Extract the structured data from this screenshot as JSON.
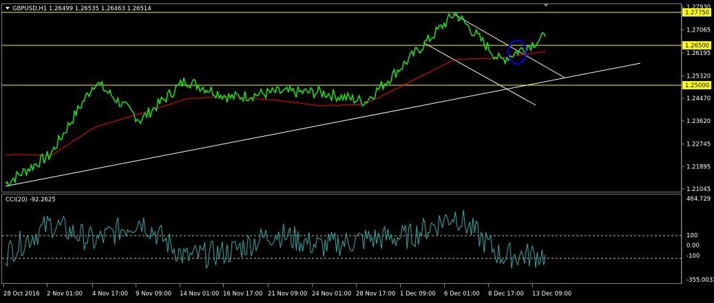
{
  "price_panel": {
    "header": "GBPUSD,H1  1.26499 1.26535 1.26463 1.26514",
    "symbol": "GBPUSD",
    "timeframe": "H1",
    "ohlc": [
      "1.26499",
      "1.26535",
      "1.26463",
      "1.26514"
    ],
    "y_ticks": [
      "1.27930",
      "1.27065",
      "1.26195",
      "1.25320",
      "1.24470",
      "1.23620",
      "1.22745",
      "1.21895",
      "1.21045"
    ],
    "level_labels": [
      "1.27750",
      "1.26500",
      "1.25000"
    ],
    "price_color": "#00ff00",
    "ma_color": "#ff0000",
    "level_color": "#ffff00",
    "trendline_color": "#ffffff",
    "marker_color": "#0000ff"
  },
  "cci_panel": {
    "header": "CCI(20) -92.2625",
    "y_ticks": [
      "464.729",
      "100",
      "0.00",
      "-100",
      "-355.0032"
    ],
    "line_color": "#20b2aa"
  },
  "time_axis": {
    "labels": [
      "28 Oct 2016",
      "2 Nov 01:00",
      "4 Nov 17:00",
      "9 Nov 09:00",
      "14 Nov 01:00",
      "16 Nov 17:00",
      "21 Nov 09:00",
      "24 Nov 01:00",
      "28 Nov 17:00",
      "1 Dec 09:00",
      "6 Dec 01:00",
      "8 Dec 17:00",
      "13 Dec 09:00"
    ]
  },
  "chart_data": [
    {
      "type": "line",
      "title": "GBPUSD,H1",
      "series": [
        {
          "name": "GBPUSD",
          "x": [
            "28 Oct 2016",
            "2 Nov 01:00",
            "4 Nov 17:00",
            "9 Nov 09:00",
            "14 Nov 01:00",
            "16 Nov 17:00",
            "21 Nov 09:00",
            "24 Nov 01:00",
            "28 Nov 17:00",
            "1 Dec 09:00",
            "6 Dec 01:00",
            "8 Dec 17:00",
            "13 Dec 09:00"
          ],
          "values": [
            1.2125,
            1.2235,
            1.251,
            1.2365,
            1.2515,
            1.245,
            1.247,
            1.247,
            1.2435,
            1.26,
            1.277,
            1.259,
            1.268
          ]
        },
        {
          "x": [
            "28 Oct 2016",
            "2 Nov 01:00",
            "4 Nov 17:00",
            "9 Nov 09:00",
            "14 Nov 01:00",
            "16 Nov 17:00",
            "21 Nov 09:00",
            "24 Nov 01:00",
            "28 Nov 17:00",
            "1 Dec 09:00",
            "6 Dec 01:00",
            "8 Dec 17:00",
            "13 Dec 09:00"
          ],
          "values": [
            1.2235,
            1.223,
            1.234,
            1.239,
            1.2445,
            1.2455,
            1.244,
            1.242,
            1.2425,
            1.251,
            1.2595,
            1.26,
            1.2625
          ]
        }
      ],
      "levels": [
        1.2775,
        1.265,
        1.25
      ],
      "ylim": [
        1.21045,
        1.2793
      ],
      "grid": false
    },
    {
      "type": "line",
      "title": "CCI(20) -92.2625",
      "series": [
        {
          "name": "CCI(20)",
          "x": [
            "28 Oct 2016",
            "2 Nov 01:00",
            "4 Nov 17:00",
            "9 Nov 09:00",
            "14 Nov 01:00",
            "16 Nov 17:00",
            "21 Nov 09:00",
            "24 Nov 01:00",
            "28 Nov 17:00",
            "1 Dec 09:00",
            "6 Dec 01:00",
            "8 Dec 17:00",
            "13 Dec 09:00"
          ],
          "values": [
            -80,
            210,
            40,
            250,
            -120,
            -60,
            120,
            -10,
            60,
            90,
            300,
            -100,
            -92.26
          ]
        }
      ],
      "reference_lines": [
        100,
        0,
        -100
      ],
      "ylim": [
        -355.0032,
        464.729
      ]
    }
  ]
}
